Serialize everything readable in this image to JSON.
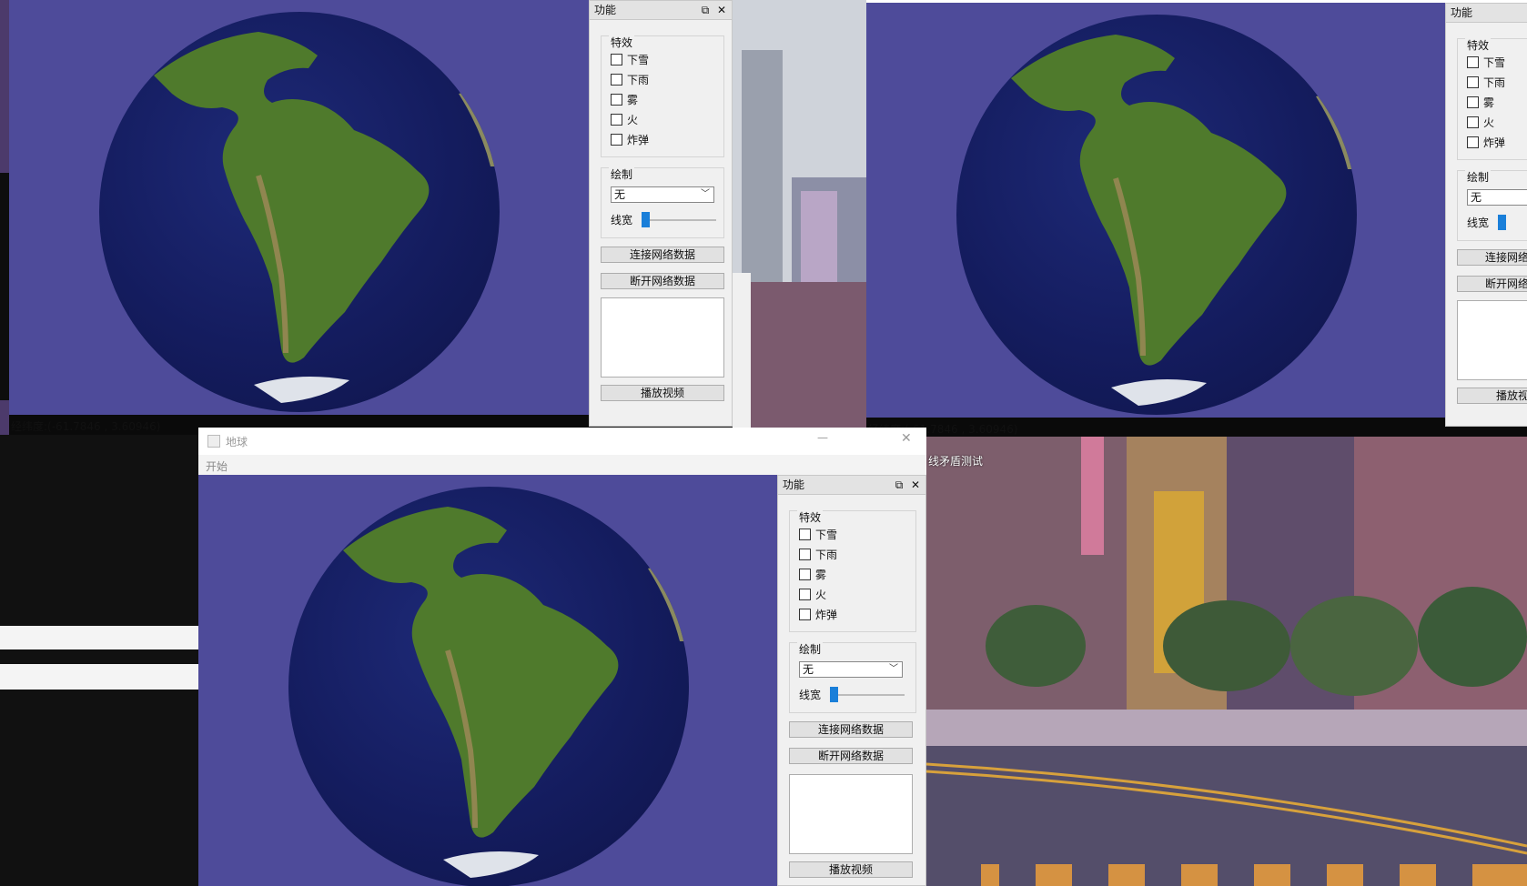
{
  "windows": {
    "top_left": {
      "panel": {
        "title": "功能",
        "effects_label": "特效",
        "effects": [
          "下雪",
          "下雨",
          "雾",
          "火",
          "炸弹"
        ],
        "draw_label": "绘制",
        "draw_select": "无",
        "line_width_label": "线宽",
        "connect_button": "连接网络数据",
        "disconnect_button": "断开网络数据",
        "play_button": "播放视频"
      },
      "coords": "经纬度:(-61.7846 , 3.60946)"
    },
    "top_right": {
      "panel": {
        "title": "功能",
        "effects_label": "特效",
        "effects": [
          "下雪",
          "下雨",
          "雾",
          "火",
          "炸弹"
        ],
        "draw_label": "绘制",
        "draw_select": "无",
        "line_width_label": "线宽",
        "connect_button": "连接网络",
        "disconnect_button": "断开网络",
        "play_button": "播放视"
      },
      "coords": "经纬度:(-61.7846 , 3.60946)"
    },
    "bottom": {
      "title": "地球",
      "menu_start": "开始",
      "panel": {
        "title": "功能",
        "effects_label": "特效",
        "effects": [
          "下雪",
          "下雨",
          "雾",
          "火",
          "炸弹"
        ],
        "draw_label": "绘制",
        "draw_select": "无",
        "line_width_label": "线宽",
        "connect_button": "连接网络数据",
        "disconnect_button": "断开网络数据",
        "play_button": "播放视频"
      }
    },
    "city_window": {
      "title": "线矛盾测试"
    }
  },
  "icons": {
    "float": "restore-icon",
    "close": "close-icon",
    "combo_arrow": "chevron-down-icon"
  },
  "colors": {
    "background_view": "#4e4b9a",
    "ocean": "#141c5e",
    "land": "#4f7a2c",
    "slider_thumb": "#1a7fd9"
  }
}
